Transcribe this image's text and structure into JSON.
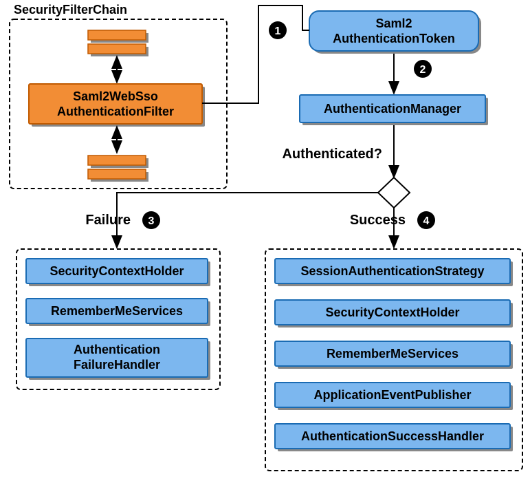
{
  "filterChain": {
    "title": "SecurityFilterChain",
    "mainFilter_line1": "Saml2WebSso",
    "mainFilter_line2": "AuthenticationFilter"
  },
  "token": {
    "line1": "Saml2",
    "line2": "AuthenticationToken"
  },
  "manager": "AuthenticationManager",
  "question": "Authenticated?",
  "branches": {
    "failure_label": "Failure",
    "success_label": "Success"
  },
  "failure_boxes": [
    "SecurityContextHolder",
    "RememberMeServices"
  ],
  "failure_box_multiline": {
    "line1": "Authentication",
    "line2": "FailureHandler"
  },
  "success_boxes": [
    "SessionAuthenticationStrategy",
    "SecurityContextHolder",
    "RememberMeServices",
    "ApplicationEventPublisher",
    "AuthenticationSuccessHandler"
  ],
  "markers": {
    "m1": "1",
    "m2": "2",
    "m3": "3",
    "m4": "4"
  },
  "colors": {
    "blue_fill": "#7cb7ef",
    "blue_stroke": "#1a6bb3",
    "orange_fill": "#f28d35",
    "orange_stroke": "#c05a00",
    "shadow": "#888",
    "black": "#000"
  }
}
